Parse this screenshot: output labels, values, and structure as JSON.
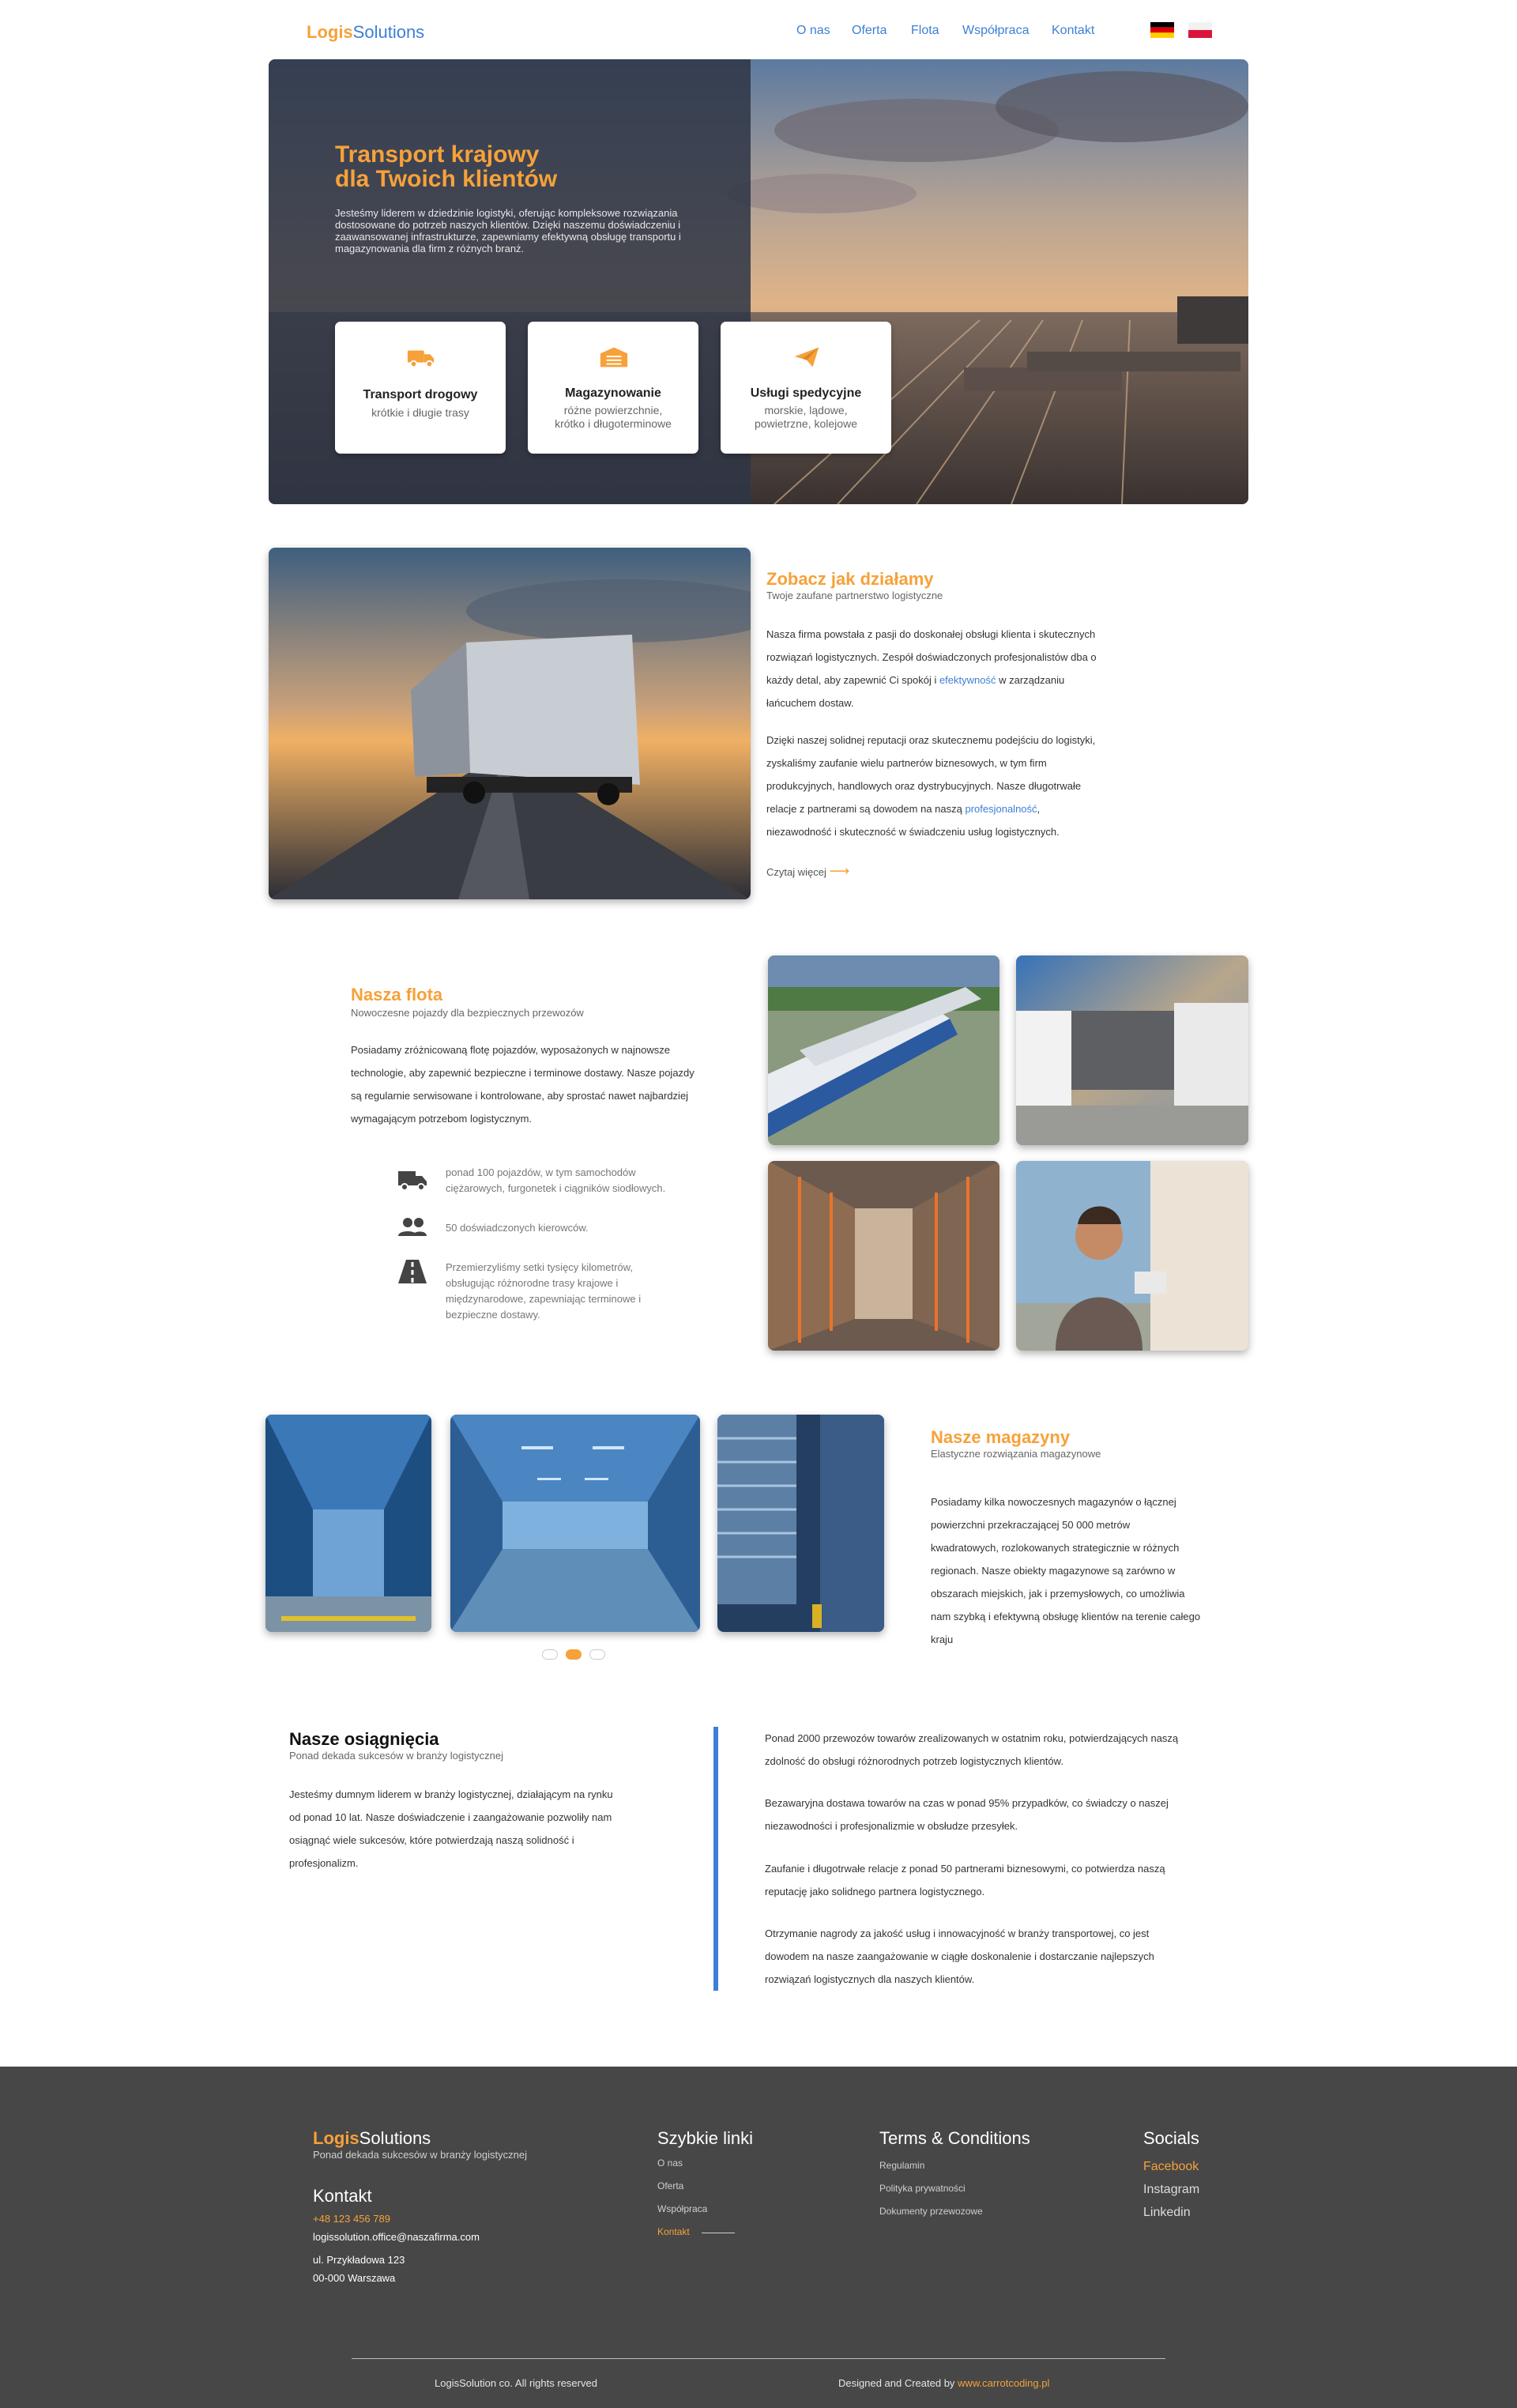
{
  "header": {
    "logo_part1": "Logis",
    "logo_part2": "Solutions",
    "nav": [
      "O nas",
      "Oferta",
      "Flota",
      "Współpraca",
      "Kontakt"
    ],
    "flags": [
      "de-flag-icon",
      "pl-flag-icon"
    ]
  },
  "hero": {
    "title_line1": "Transport krajowy",
    "title_line2": "dla Twoich klientów",
    "text": "Jesteśmy liderem w dziedzinie logistyki, oferując kompleksowe rozwiązania dostosowane do potrzeb naszych klientów. Dzięki naszemu  doświadczeniu i zaawansowanej infrastrukturze, zapewniamy efektywną  obsługę transportu i magazynowania dla firm z różnych branż.",
    "cards": [
      {
        "icon": "truck-icon",
        "title": "Transport drogowy",
        "line1": "krótkie i długie trasy",
        "line2": ""
      },
      {
        "icon": "warehouse-icon",
        "title": "Magazynowanie",
        "line1": "różne powierzchnie,",
        "line2": "krótko i długoterminowe"
      },
      {
        "icon": "paper-plane-icon",
        "title": "Usługi spedycyjne",
        "line1": "morskie, lądowe,",
        "line2": "powietrzne, kolejowe"
      }
    ]
  },
  "about": {
    "title": "Zobacz jak działamy",
    "subtitle": "Twoje zaufane partnerstwo logistyczne",
    "p1a": "Nasza firma powstała z pasji do doskonałej obsługi klienta i skutecznych",
    "p1b": "rozwiązań logistycznych. Zespół doświadczonych profesjonalistów dba o",
    "p1c": "każdy detal, aby zapewnić Ci spokój i ",
    "p1_link": "efektywność",
    "p1d": " w zarządzaniu",
    "p1e": "łańcuchem dostaw.",
    "p2a": "Dzięki naszej solidnej reputacji oraz skutecznemu podejściu do  logistyki,",
    "p2b": "zyskaliśmy zaufanie wielu partnerów biznesowych, w tym firm",
    "p2c": "produkcyjnych, handlowych oraz dystrybucyjnych. Nasze długotrwałe",
    "p2d": "relacje z partnerami są dowodem na naszą ",
    "p2_link": "profesjonalność",
    "p2e": ",",
    "p2f": "niezawodność i  skuteczność w świadczeniu usług logistycznych.",
    "read_more": "Czytaj więcej"
  },
  "fleet": {
    "title": "Nasza flota",
    "subtitle": "Nowoczesne pojazdy dla bezpiecznych przewozów",
    "p": [
      "Posiadamy zróżnicowaną flotę pojazdów, wyposażonych w najnowsze",
      "technologie, aby zapewnić bezpieczne i terminowe dostawy. Nasze pojazdy",
      "są regularnie serwisowane i kontrolowane, aby sprostać nawet najbardziej",
      "wymagającym potrzebom logistycznym."
    ],
    "features": [
      {
        "icon": "truck-icon",
        "lines": [
          "ponad 100 pojazdów, w tym samochodów",
          "ciężarowych, furgonetek i ciągników siodłowych."
        ]
      },
      {
        "icon": "people-icon",
        "lines": [
          "50 doświadczonych kierowców."
        ]
      },
      {
        "icon": "road-icon",
        "lines": [
          "Przemierzyliśmy setki tysięcy kilometrów,",
          "obsługując różnorodne trasy  krajowe i",
          "międzynarodowe, zapewniając terminowe i",
          "bezpieczne dostawy."
        ]
      }
    ]
  },
  "warehouses": {
    "title": "Nasze magazyny",
    "subtitle": "Elastyczne rozwiązania magazynowe",
    "p": [
      "Posiadamy kilka nowoczesnych magazynów o łącznej",
      "powierzchni  przekraczającej 50 000 metrów",
      "kwadratowych, rozlokowanych strategicznie w  różnych",
      "regionach. Nasze obiekty magazynowe są zarówno w",
      "obszarach  miejskich, jak i przemysłowych, co umożliwia",
      "nam szybką i efektywną  obsługę klientów na terenie całego",
      "kraju"
    ],
    "carousel_active": 1
  },
  "achievements": {
    "title": "Nasze osiągnięcia",
    "subtitle": "Ponad dekada sukcesów w branży logistycznej",
    "p": [
      "Jesteśmy dumnym liderem w branży logistycznej, działającym na rynku",
      "od  ponad 10 lat. Nasze doświadczenie i zaangażowanie pozwoliły nam",
      "osiągnąć  wiele sukcesów, które potwierdzają naszą solidność i",
      "profesjonalizm."
    ],
    "items": [
      [
        "Ponad 2000 przewozów towarów zrealizowanych w ostatnim roku,  potwierdzających naszą",
        "zdolność do obsługi różnorodnych potrzeb  logistycznych klientów."
      ],
      [
        "Bezawaryjna dostawa towarów na czas w ponad 95% przypadków, co świadczy o  naszej",
        "niezawodności i profesjonalizmie w obsłudze przesyłek."
      ],
      [
        "Zaufanie i długotrwałe relacje z ponad 50 partnerami biznesowymi, co  potwierdza naszą",
        "reputację jako solidnego partnera logistycznego."
      ],
      [
        "Otrzymanie nagrody za jakość usług i innowacyjność w branży  transportowej, co jest",
        "dowodem na nasze zaangażowanie w ciągłe  doskonalenie i dostarczanie najlepszych",
        "rozwiązań logistycznych dla  naszych klientów."
      ]
    ]
  },
  "footer": {
    "logo_part1": "Logis",
    "logo_part2": "Solutions",
    "tagline": "Ponad dekada sukcesów w branży logistycznej",
    "contact_title": "Kontakt",
    "phone": "+48 123 456 789",
    "email": " logissolution.office@naszafirma.com",
    "address1": "ul. Przykładowa 123",
    "address2": "00-000 Warszawa",
    "quick_title": "Szybkie linki",
    "quick": [
      "O nas",
      "Oferta",
      "Współpraca",
      "Kontakt"
    ],
    "terms_title": "Terms & Conditions",
    "terms": [
      "Regulamin",
      "Polityka prywatności",
      "Dokumenty przewozowe"
    ],
    "social_title": "Socials",
    "socials": [
      "Facebook",
      "Instagram",
      "Linkedin"
    ],
    "copyright": "LogisSolution co. All rights reserved",
    "designed": "Designed and Created by ",
    "designed_link": "www.carrotcoding.pl"
  },
  "colors": {
    "accent": "#f6a13a",
    "blue": "#3d7fd6",
    "footer_bg": "#474747"
  }
}
